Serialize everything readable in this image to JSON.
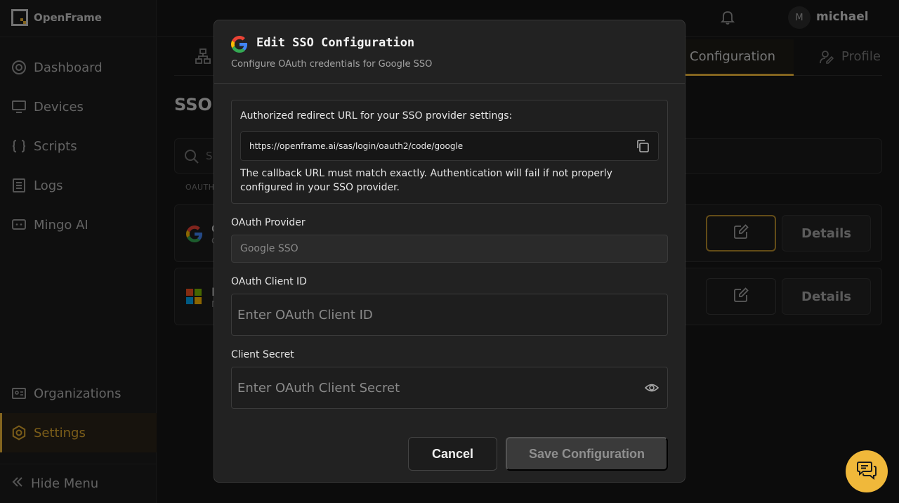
{
  "app": {
    "name": "OpenFrame"
  },
  "sidebar": {
    "items": [
      {
        "label": "Dashboard",
        "icon": "dashboard-icon"
      },
      {
        "label": "Devices",
        "icon": "monitor-icon"
      },
      {
        "label": "Scripts",
        "icon": "braces-icon"
      },
      {
        "label": "Logs",
        "icon": "logs-icon"
      },
      {
        "label": "Mingo AI",
        "icon": "ai-chat-icon"
      }
    ],
    "bottom_items": [
      {
        "label": "Organizations",
        "icon": "id-card-icon"
      },
      {
        "label": "Settings",
        "icon": "gear-icon",
        "active": true
      }
    ],
    "hide_menu": "Hide Menu"
  },
  "topbar": {
    "user_initial": "M",
    "username": "michael"
  },
  "background": {
    "tab_config": "Configuration",
    "tab_profile": "Profile",
    "page_title": "SSO",
    "search_placeholder": "S",
    "col_header": "OAUTH",
    "rows": [
      {
        "name": "G",
        "sub": "C",
        "details": "Details"
      },
      {
        "name": "I",
        "sub": "M",
        "details": "Details"
      }
    ]
  },
  "modal": {
    "title": "Edit SSO Configuration",
    "subtitle": "Configure OAuth credentials for Google SSO",
    "redirect_label": "Authorized redirect URL for your SSO provider settings:",
    "redirect_url": "https://openframe.ai/sas/login/oauth2/code/google",
    "redirect_note": "The callback URL must match exactly. Authentication will fail if not properly configured in your SSO provider.",
    "provider_label": "OAuth Provider",
    "provider_value": "Google SSO",
    "client_id_label": "OAuth Client ID",
    "client_id_placeholder": "Enter OAuth Client ID",
    "client_secret_label": "Client Secret",
    "client_secret_placeholder": "Enter OAuth Client Secret",
    "cancel_label": "Cancel",
    "save_label": "Save Configuration"
  },
  "colors": {
    "accent": "#f0b83a",
    "background": "#161616",
    "modal": "#222222"
  }
}
